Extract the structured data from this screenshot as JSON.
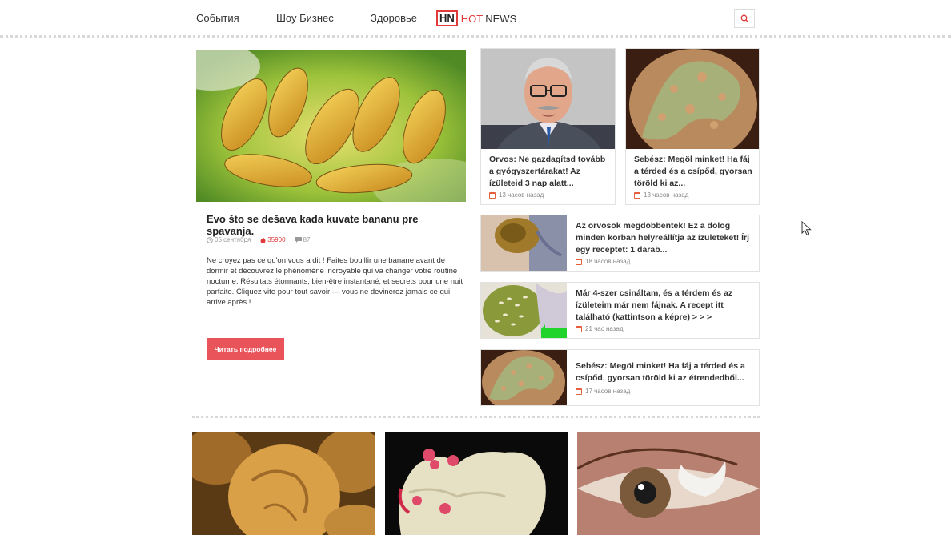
{
  "nav": {
    "items": [
      "События",
      "Шоу Бизнес",
      "Здоровье"
    ],
    "logo_box": "HN",
    "logo_hot": "HOT",
    "logo_news": "NEWS"
  },
  "featured": {
    "title": "Evo što se dešava kada kuvate bananu pre spavanja.",
    "date": "05 сентября",
    "views": "35900",
    "comments": "87",
    "text": "Ne croyez pas ce qu'on vous a dit ! Faites bouillir une banane avant de dormir et découvrez le phénomène incroyable qui va changer votre routine nocturne. Résultats étonnants, bien-être instantané, et secrets pour une nuit parfaite. Cliquez vite pour tout savoir — vous ne devinerez jamais ce qui arrive après !",
    "button": "Читать подробнее"
  },
  "top_cards": [
    {
      "title": "Orvos: Ne gazdagítsd tovább a gyógyszertárakat! Az ízületeid 3 nap alatt...",
      "time": "13 часов назад",
      "image": "doctor-portrait"
    },
    {
      "title": "Sebész: Megöl minket! Ha fáj a térded és a csípőd, gyorsan töröld ki az...",
      "time": "13 часов назад",
      "image": "knee-joint"
    }
  ],
  "row_cards": [
    {
      "title": "Az orvosok megdöbbentek! Ez a dolog minden korban helyreállítja az ízületeket! Írj egy receptet: 1 darab...",
      "time": "18 часов назад",
      "image": "knee-paste"
    },
    {
      "title": "Már 4-szer csináltam, és a térdem és az ízületeim már nem fájnak. A recept itt található (kattintson a képre) > > >",
      "time": "21 час назад",
      "image": "seeds-bowl"
    },
    {
      "title": "Sebész: Megöl minket! Ha fáj a térded és a csípőd, gyorsan töröld ki az étrendedből...",
      "time": "17 часов назад",
      "image": "knee-joint"
    }
  ],
  "bottom_images": [
    "dried-figs",
    "knee-bone",
    "eye-closeup"
  ],
  "colors": {
    "accent": "#e03a3a",
    "button": "#e9545b",
    "calendar": "#e65f3c"
  },
  "icons": [
    "search-icon",
    "clock-icon",
    "fire-icon",
    "comment-icon",
    "calendar-icon",
    "mouse-cursor-icon"
  ]
}
